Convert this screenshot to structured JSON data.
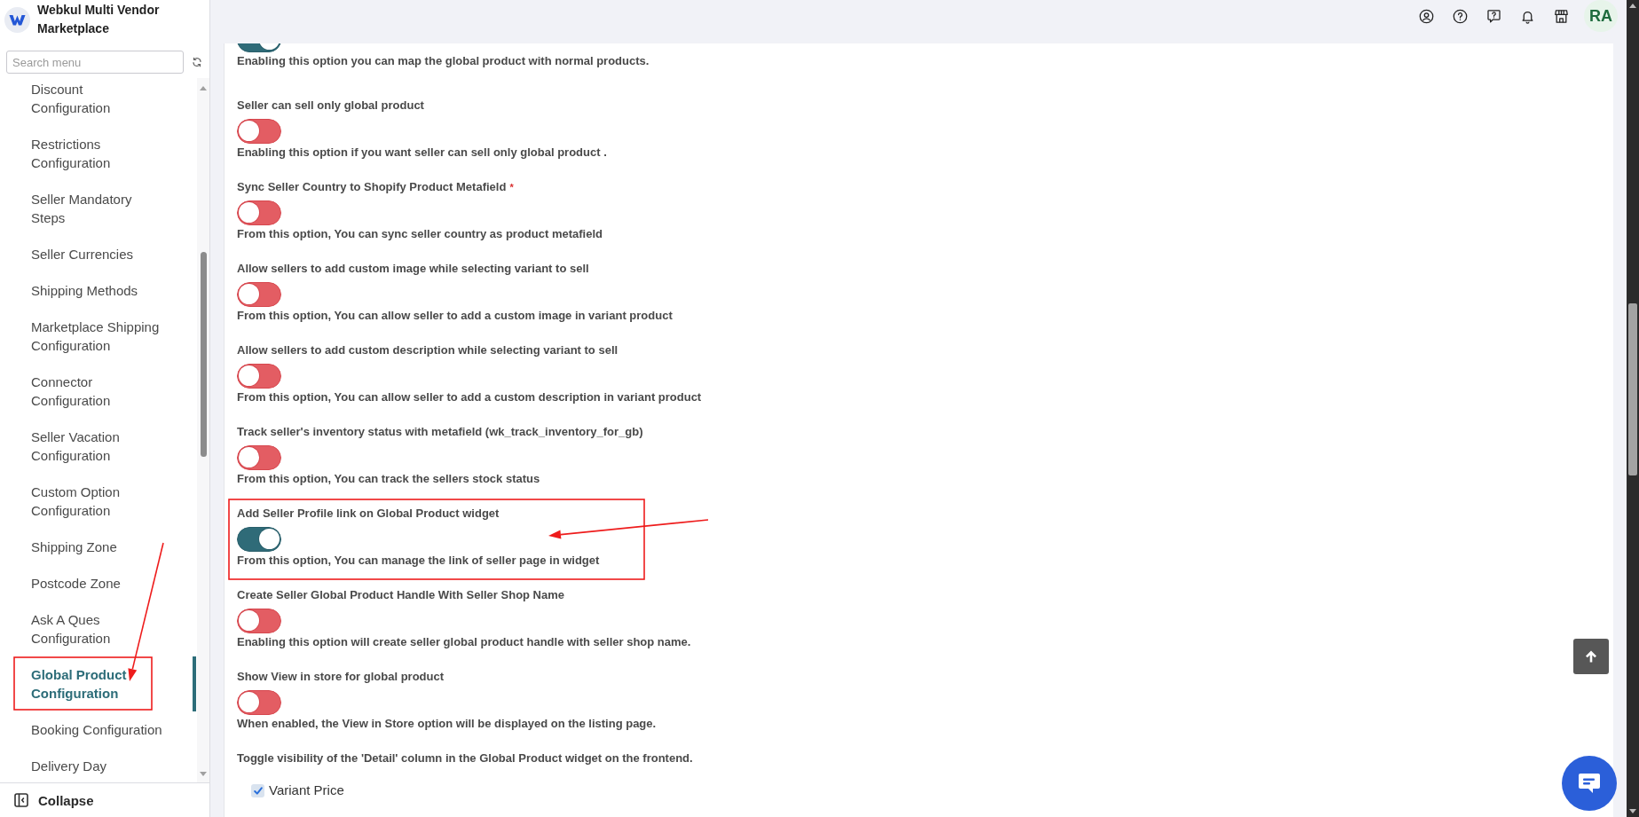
{
  "sidebar": {
    "brand": "Webkul Multi Vendor Marketplace",
    "search": {
      "placeholder": "Search menu"
    },
    "items": [
      {
        "label": "Discount Configuration",
        "selected": false
      },
      {
        "label": "Restrictions Configuration",
        "selected": false
      },
      {
        "label": "Seller Mandatory Steps",
        "selected": false
      },
      {
        "label": "Seller Currencies",
        "selected": false
      },
      {
        "label": "Shipping Methods",
        "selected": false
      },
      {
        "label": "Marketplace Shipping Configuration",
        "selected": false
      },
      {
        "label": "Connector Configuration",
        "selected": false
      },
      {
        "label": "Seller Vacation Configuration",
        "selected": false
      },
      {
        "label": "Custom Option Configuration",
        "selected": false
      },
      {
        "label": "Shipping Zone",
        "selected": false
      },
      {
        "label": "Postcode Zone",
        "selected": false
      },
      {
        "label": "Ask A Ques Configuration",
        "selected": false
      },
      {
        "label": "Global Product Configuration",
        "selected": true
      },
      {
        "label": "Booking Configuration",
        "selected": false
      },
      {
        "label": "Delivery Day",
        "selected": false
      }
    ],
    "collapse": "Collapse"
  },
  "header": {
    "avatar": "RA"
  },
  "settings": [
    {
      "on": true,
      "description": "Enabling this option you can map the global product with normal products."
    },
    {
      "label": "Seller can sell only global product",
      "on": false,
      "description": "Enabling this option if you want seller can sell only global product ."
    },
    {
      "label": "Sync Seller Country to Shopify Product Metafield",
      "required_mark": "*",
      "on": false,
      "description": "From this option, You can sync seller country as product metafield"
    },
    {
      "label": "Allow sellers to add custom image while selecting variant to sell",
      "on": false,
      "description": "From this option, You can allow seller to add a custom image in variant product"
    },
    {
      "label": "Allow sellers to add custom description while selecting variant to sell",
      "on": false,
      "description": "From this option, You can allow seller to add a custom description in variant product"
    },
    {
      "label": "Track seller's inventory status with metafield (wk_track_inventory_for_gb)",
      "on": false,
      "description": "From this option, You can track the sellers stock status"
    },
    {
      "label": "Add Seller Profile link on Global Product widget",
      "on": true,
      "description": "From this option, You can manage the link of seller page in widget"
    },
    {
      "label": "Create Seller Global Product Handle With Seller Shop Name",
      "on": false,
      "description": "Enabling this option will create seller global product handle with seller shop name."
    },
    {
      "label": "Show View in store for global product",
      "on": false,
      "description": "When enabled, the View in Store option will be displayed on the listing page."
    }
  ],
  "detail_columns": {
    "title": "Toggle visibility of the 'Detail' column in the Global Product widget on the frontend.",
    "options": [
      {
        "label": "Variant Price",
        "checked": true
      }
    ]
  }
}
